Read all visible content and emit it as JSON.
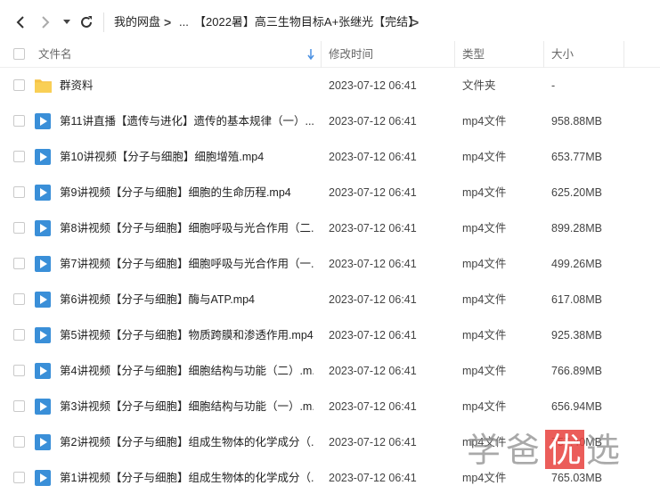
{
  "nav": {
    "back_icon": "chevron-left-icon",
    "forward_icon": "chevron-right-icon",
    "history_icon": "caret-down-icon",
    "refresh_icon": "refresh-icon",
    "breadcrumb": {
      "root": "我的网盘",
      "ellipsis": "...",
      "current": "【2022暑】高三生物目标A+张继光【完结】",
      "separator": ">"
    }
  },
  "columns": {
    "name": "文件名",
    "mtime": "修改时间",
    "type": "类型",
    "size": "大小"
  },
  "files": [
    {
      "icon": "folder-icon",
      "name": "群资料",
      "mtime": "2023-07-12 06:41",
      "type": "文件夹",
      "size": "-"
    },
    {
      "icon": "video-file-icon",
      "name": "第11讲直播【遗传与进化】遗传的基本规律（一）....",
      "mtime": "2023-07-12 06:41",
      "type": "mp4文件",
      "size": "958.88MB"
    },
    {
      "icon": "video-file-icon",
      "name": "第10讲视频【分子与细胞】细胞增殖.mp4",
      "mtime": "2023-07-12 06:41",
      "type": "mp4文件",
      "size": "653.77MB"
    },
    {
      "icon": "video-file-icon",
      "name": "第9讲视频【分子与细胞】细胞的生命历程.mp4",
      "mtime": "2023-07-12 06:41",
      "type": "mp4文件",
      "size": "625.20MB"
    },
    {
      "icon": "video-file-icon",
      "name": "第8讲视频【分子与细胞】细胞呼吸与光合作用（二...",
      "mtime": "2023-07-12 06:41",
      "type": "mp4文件",
      "size": "899.28MB"
    },
    {
      "icon": "video-file-icon",
      "name": "第7讲视频【分子与细胞】细胞呼吸与光合作用（一...",
      "mtime": "2023-07-12 06:41",
      "type": "mp4文件",
      "size": "499.26MB"
    },
    {
      "icon": "video-file-icon",
      "name": "第6讲视频【分子与细胞】酶与ATP.mp4",
      "mtime": "2023-07-12 06:41",
      "type": "mp4文件",
      "size": "617.08MB"
    },
    {
      "icon": "video-file-icon",
      "name": "第5讲视频【分子与细胞】物质跨膜和渗透作用.mp4",
      "mtime": "2023-07-12 06:41",
      "type": "mp4文件",
      "size": "925.38MB"
    },
    {
      "icon": "video-file-icon",
      "name": "第4讲视频【分子与细胞】细胞结构与功能（二）.m...",
      "mtime": "2023-07-12 06:41",
      "type": "mp4文件",
      "size": "766.89MB"
    },
    {
      "icon": "video-file-icon",
      "name": "第3讲视频【分子与细胞】细胞结构与功能（一）.m...",
      "mtime": "2023-07-12 06:41",
      "type": "mp4文件",
      "size": "656.94MB"
    },
    {
      "icon": "video-file-icon",
      "name": "第2讲视频【分子与细胞】组成生物体的化学成分（...",
      "mtime": "2023-07-12 06:41",
      "type": "mp4文件",
      "size": "757.40MB"
    },
    {
      "icon": "video-file-icon",
      "name": "第1讲视频【分子与细胞】组成生物体的化学成分（...",
      "mtime": "2023-07-12 06:41",
      "type": "mp4文件",
      "size": "765.03MB"
    }
  ],
  "watermark": {
    "text": "学爸优选"
  },
  "colors": {
    "video_icon": "#3a8fd8",
    "folder_icon": "#f6c244",
    "sort_arrow": "#4a90e2",
    "watermark_red": "#e8413d"
  }
}
